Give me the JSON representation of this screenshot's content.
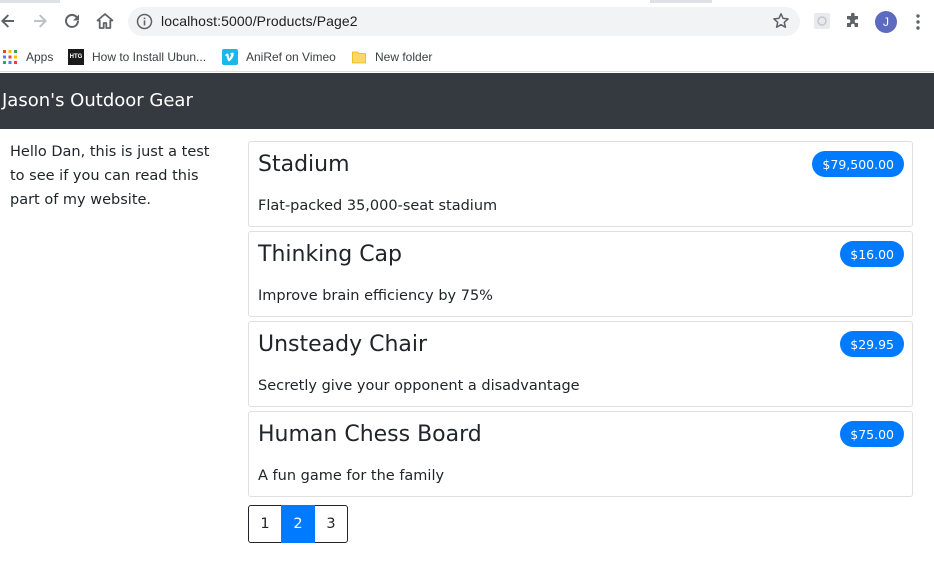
{
  "browser": {
    "url": "localhost:5000/Products/Page2",
    "profile_initial": "J",
    "bookmarks": [
      {
        "label": "Apps",
        "icon": "apps-grid-icon"
      },
      {
        "label": "How to Install Ubun...",
        "icon": "htg-favicon",
        "favicon_text": "HTG"
      },
      {
        "label": "AniRef on Vimeo",
        "icon": "vimeo-favicon"
      },
      {
        "label": "New folder",
        "icon": "folder-icon"
      }
    ]
  },
  "site": {
    "brand": "Jason's Outdoor Gear",
    "sidebar_text": "Hello Dan, this is just a test to see if you can read this part of my website."
  },
  "products": [
    {
      "name": "Stadium",
      "price": "$79,500.00",
      "description": "Flat-packed 35,000-seat stadium"
    },
    {
      "name": "Thinking Cap",
      "price": "$16.00",
      "description": "Improve brain efficiency by 75%"
    },
    {
      "name": "Unsteady Chair",
      "price": "$29.95",
      "description": "Secretly give your opponent a disadvantage"
    },
    {
      "name": "Human Chess Board",
      "price": "$75.00",
      "description": "A fun game for the family"
    }
  ],
  "pagination": {
    "pages": [
      "1",
      "2",
      "3"
    ],
    "current": "2"
  },
  "colors": {
    "navbar": "#343a40",
    "accent": "#007bff",
    "avatar": "#5c6bc0"
  }
}
